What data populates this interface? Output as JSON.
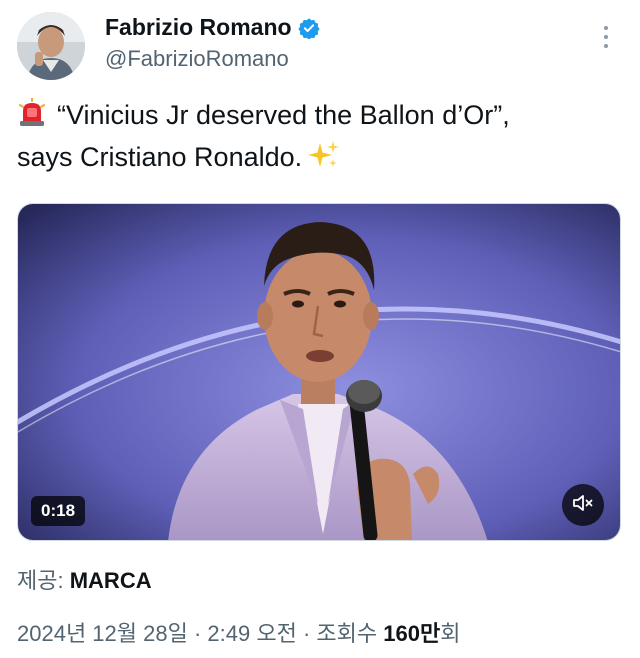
{
  "author": {
    "display_name": "Fabrizio Romano",
    "handle": "@FabrizioRomano",
    "verified_icon": "verified-badge-icon",
    "avatar_icon": "avatar-photo"
  },
  "tweet": {
    "emoji_start": "rotating-light-icon",
    "text_line1": "“Vinicius Jr deserved the Ballon d’Or”,",
    "text_line2": "says Cristiano Ronaldo.",
    "emoji_end": "sparkles-icon"
  },
  "video": {
    "duration": "0:18",
    "mute_icon": "muted-speaker-icon"
  },
  "source": {
    "label": "제공:",
    "name": "MARCA"
  },
  "meta": {
    "date": "2024년 12월 28일",
    "separator": "·",
    "time": "2:49 오전",
    "views_label": "조회수",
    "views_count": "160만",
    "views_suffix": "회"
  },
  "colors": {
    "text_primary": "#0f1419",
    "text_secondary": "#536471",
    "verified_blue": "#1d9bf0",
    "video_stage": "#6f6fc9"
  }
}
